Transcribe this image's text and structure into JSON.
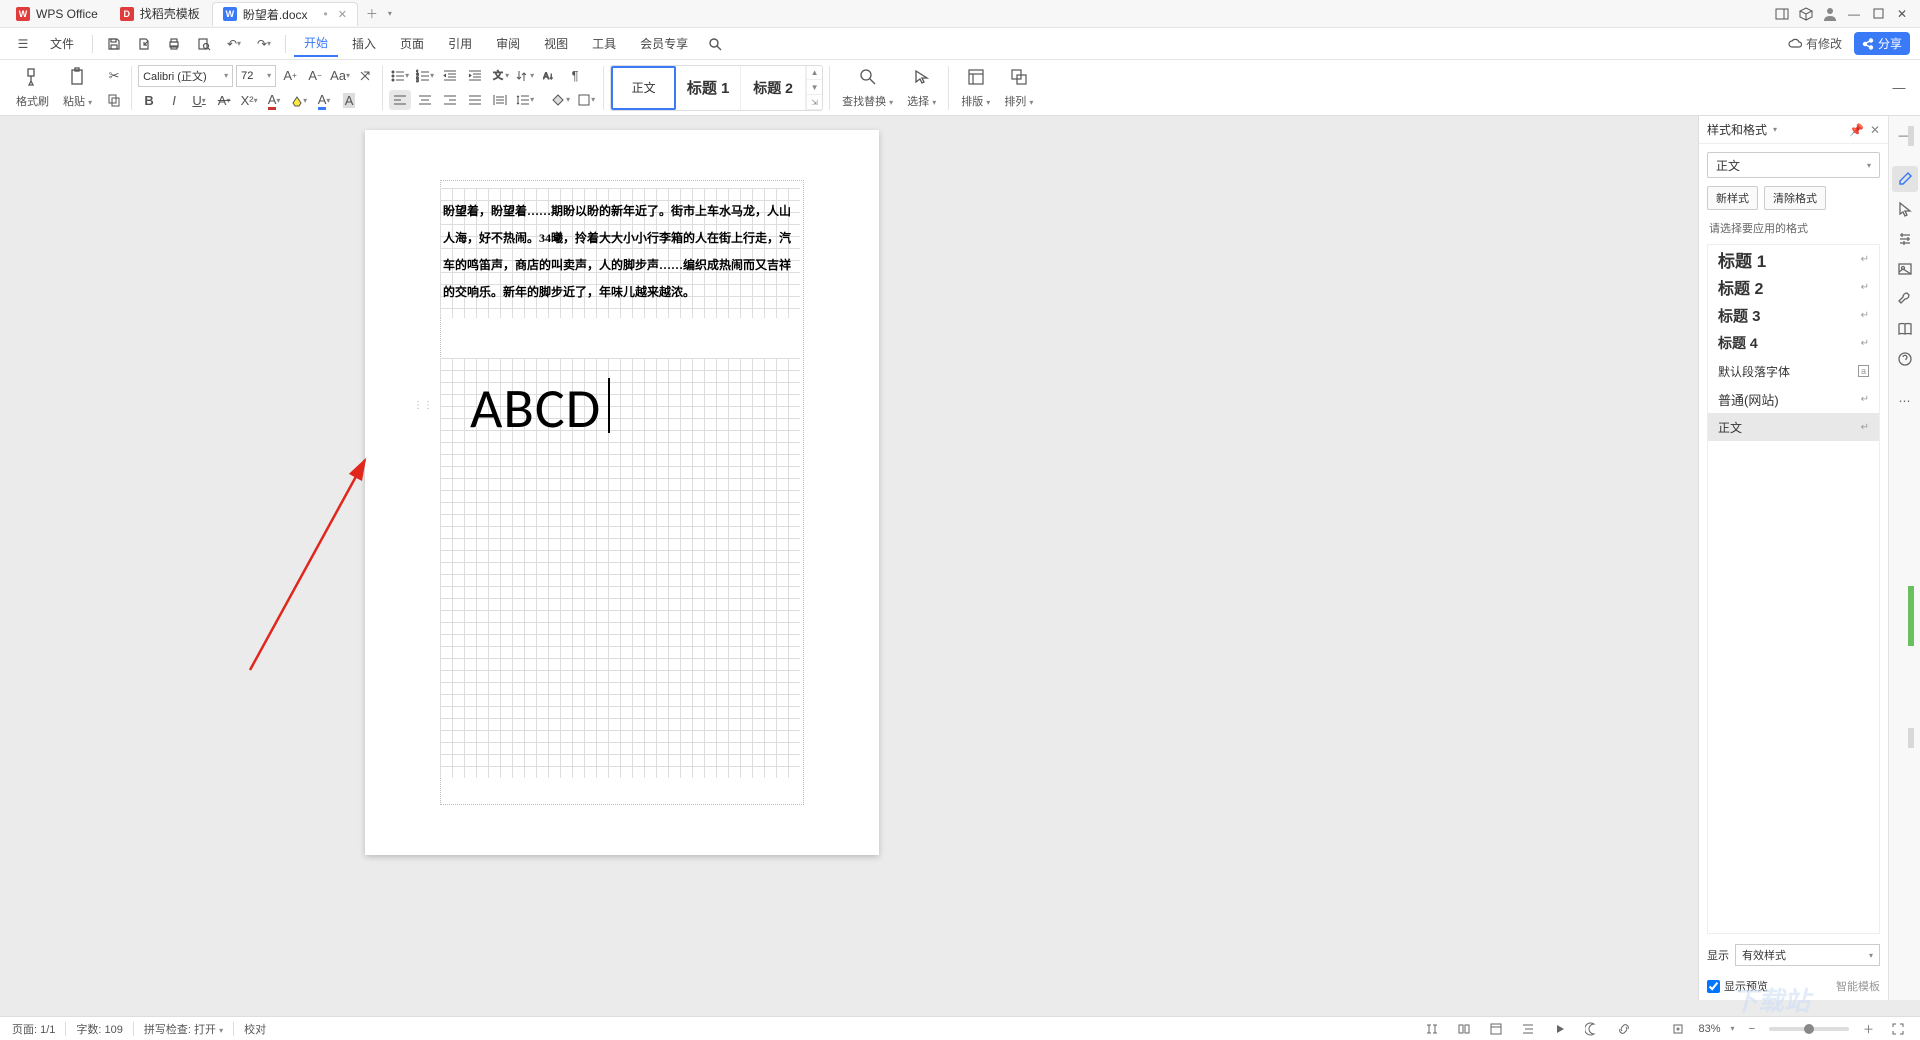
{
  "tabs": [
    {
      "icon": "W",
      "iconBg": "#e03c3c",
      "label": "WPS Office"
    },
    {
      "icon": "D",
      "iconBg": "#e03c3c",
      "label": "找稻壳模板"
    },
    {
      "icon": "W",
      "iconBg": "#3a7af7",
      "label": "盼望着.docx"
    }
  ],
  "menubar": {
    "file": "文件",
    "items": [
      "开始",
      "插入",
      "页面",
      "引用",
      "审阅",
      "视图",
      "工具",
      "会员专享"
    ],
    "active": 0,
    "hasChanges": "有修改",
    "share": "分享"
  },
  "toolbar": {
    "formatBrush": "格式刷",
    "paste": "粘贴",
    "font": "Calibri (正文)",
    "fontSize": "72",
    "styleGallery": [
      "正文",
      "标题 1",
      "标题 2"
    ],
    "findReplace": "查找替换",
    "select": "选择",
    "layout": "排版",
    "arrange": "排列"
  },
  "document": {
    "paragraph": "盼望着，盼望着……期盼以盼的新年近了。街市上车水马龙，人山人海，好不热闹。34曦，拎着大大小小行李箱的人在街上行走，汽车的鸣笛声，商店的叫卖声，人的脚步声……编织成热闹而又吉祥的交响乐。新年的脚步近了，年味儿越来越浓。",
    "bigText": "ABCD"
  },
  "stylePanel": {
    "title": "样式和格式",
    "current": "正文",
    "newStyle": "新样式",
    "clearFmt": "清除格式",
    "prompt": "请选择要应用的格式",
    "list": [
      {
        "label": "标题 1",
        "size": "17px",
        "weight": "bold"
      },
      {
        "label": "标题 2",
        "size": "16px",
        "weight": "bold"
      },
      {
        "label": "标题 3",
        "size": "15px",
        "weight": "bold"
      },
      {
        "label": "标题 4",
        "size": "14px",
        "weight": "bold"
      },
      {
        "label": "默认段落字体",
        "size": "12px",
        "weight": "normal",
        "lock": true
      },
      {
        "label": "普通(网站)",
        "size": "13px",
        "weight": "normal"
      },
      {
        "label": "正文",
        "size": "12px",
        "weight": "normal",
        "selected": true
      }
    ],
    "showLabel": "显示",
    "showSelect": "有效样式",
    "showPreview": "显示预览",
    "smartTpl": "智能模板"
  },
  "status": {
    "page": "页面: 1/1",
    "words": "字数: 109",
    "spell": "拼写检查: 打开",
    "proof": "校对",
    "zoom": "83%"
  }
}
